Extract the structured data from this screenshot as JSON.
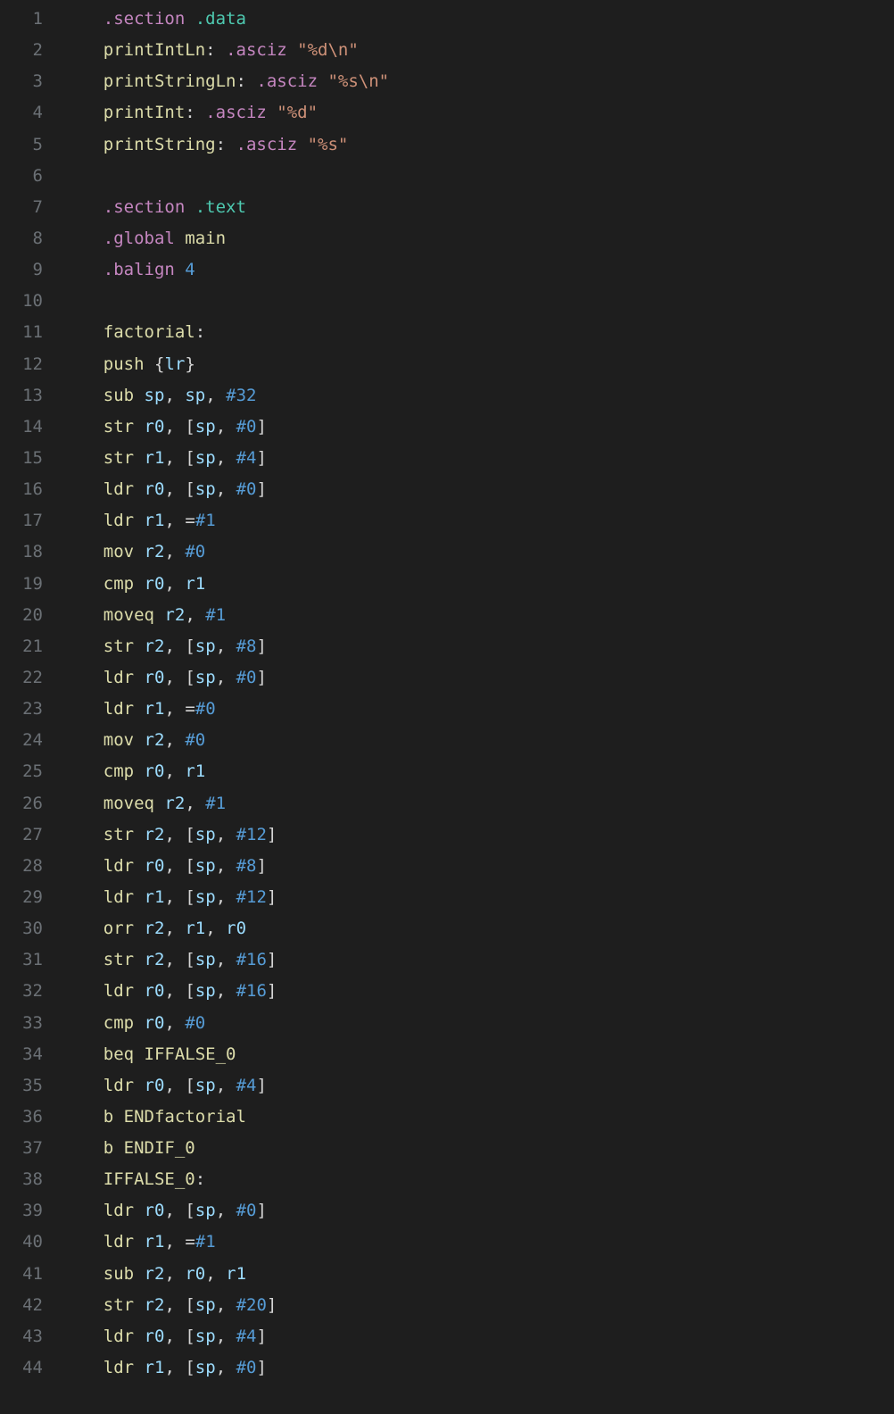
{
  "lines": [
    {
      "num": 1,
      "tokens": [
        [
          "kw",
          ".section"
        ],
        [
          "sp",
          " "
        ],
        [
          "sec",
          ".data"
        ]
      ]
    },
    {
      "num": 2,
      "tokens": [
        [
          "label",
          "printIntLn"
        ],
        [
          "punc",
          ":"
        ],
        [
          "sp",
          " "
        ],
        [
          "dir",
          ".asciz"
        ],
        [
          "sp",
          " "
        ],
        [
          "str",
          "\"%d\\n\""
        ]
      ]
    },
    {
      "num": 3,
      "tokens": [
        [
          "label",
          "printStringLn"
        ],
        [
          "punc",
          ":"
        ],
        [
          "sp",
          " "
        ],
        [
          "dir",
          ".asciz"
        ],
        [
          "sp",
          " "
        ],
        [
          "str",
          "\"%s\\n\""
        ]
      ]
    },
    {
      "num": 4,
      "tokens": [
        [
          "label",
          "printInt"
        ],
        [
          "punc",
          ":"
        ],
        [
          "sp",
          " "
        ],
        [
          "dir",
          ".asciz"
        ],
        [
          "sp",
          " "
        ],
        [
          "str",
          "\"%d\""
        ]
      ]
    },
    {
      "num": 5,
      "tokens": [
        [
          "label",
          "printString"
        ],
        [
          "punc",
          ":"
        ],
        [
          "sp",
          " "
        ],
        [
          "dir",
          ".asciz"
        ],
        [
          "sp",
          " "
        ],
        [
          "str",
          "\"%s\""
        ]
      ]
    },
    {
      "num": 6,
      "tokens": []
    },
    {
      "num": 7,
      "tokens": [
        [
          "kw",
          ".section"
        ],
        [
          "sp",
          " "
        ],
        [
          "sec",
          ".text"
        ]
      ]
    },
    {
      "num": 8,
      "tokens": [
        [
          "kw",
          ".global"
        ],
        [
          "sp",
          " "
        ],
        [
          "main",
          "main"
        ]
      ]
    },
    {
      "num": 9,
      "tokens": [
        [
          "kw",
          ".balign"
        ],
        [
          "sp",
          " "
        ],
        [
          "num",
          "4"
        ]
      ]
    },
    {
      "num": 10,
      "tokens": []
    },
    {
      "num": 11,
      "tokens": [
        [
          "label",
          "factorial"
        ],
        [
          "punc",
          ":"
        ]
      ]
    },
    {
      "num": 12,
      "tokens": [
        [
          "mn",
          "push"
        ],
        [
          "sp",
          " "
        ],
        [
          "punc",
          "{"
        ],
        [
          "reg",
          "lr"
        ],
        [
          "punc",
          "}"
        ]
      ]
    },
    {
      "num": 13,
      "tokens": [
        [
          "mn",
          "sub"
        ],
        [
          "sp",
          " "
        ],
        [
          "reg",
          "sp"
        ],
        [
          "punc",
          ","
        ],
        [
          "sp",
          " "
        ],
        [
          "reg",
          "sp"
        ],
        [
          "punc",
          ","
        ],
        [
          "sp",
          " "
        ],
        [
          "num",
          "#32"
        ]
      ]
    },
    {
      "num": 14,
      "tokens": [
        [
          "mn",
          "str"
        ],
        [
          "sp",
          " "
        ],
        [
          "reg",
          "r0"
        ],
        [
          "punc",
          ","
        ],
        [
          "sp",
          " "
        ],
        [
          "punc",
          "["
        ],
        [
          "reg",
          "sp"
        ],
        [
          "punc",
          ","
        ],
        [
          "sp",
          " "
        ],
        [
          "num",
          "#0"
        ],
        [
          "punc",
          "]"
        ]
      ]
    },
    {
      "num": 15,
      "tokens": [
        [
          "mn",
          "str"
        ],
        [
          "sp",
          " "
        ],
        [
          "reg",
          "r1"
        ],
        [
          "punc",
          ","
        ],
        [
          "sp",
          " "
        ],
        [
          "punc",
          "["
        ],
        [
          "reg",
          "sp"
        ],
        [
          "punc",
          ","
        ],
        [
          "sp",
          " "
        ],
        [
          "num",
          "#4"
        ],
        [
          "punc",
          "]"
        ]
      ]
    },
    {
      "num": 16,
      "tokens": [
        [
          "mn",
          "ldr"
        ],
        [
          "sp",
          " "
        ],
        [
          "reg",
          "r0"
        ],
        [
          "punc",
          ","
        ],
        [
          "sp",
          " "
        ],
        [
          "punc",
          "["
        ],
        [
          "reg",
          "sp"
        ],
        [
          "punc",
          ","
        ],
        [
          "sp",
          " "
        ],
        [
          "num",
          "#0"
        ],
        [
          "punc",
          "]"
        ]
      ]
    },
    {
      "num": 17,
      "tokens": [
        [
          "mn",
          "ldr"
        ],
        [
          "sp",
          " "
        ],
        [
          "reg",
          "r1"
        ],
        [
          "punc",
          ","
        ],
        [
          "sp",
          " "
        ],
        [
          "eq",
          "="
        ],
        [
          "num",
          "#1"
        ]
      ]
    },
    {
      "num": 18,
      "tokens": [
        [
          "mn",
          "mov"
        ],
        [
          "sp",
          " "
        ],
        [
          "reg",
          "r2"
        ],
        [
          "punc",
          ","
        ],
        [
          "sp",
          " "
        ],
        [
          "num",
          "#0"
        ]
      ]
    },
    {
      "num": 19,
      "tokens": [
        [
          "mn",
          "cmp"
        ],
        [
          "sp",
          " "
        ],
        [
          "reg",
          "r0"
        ],
        [
          "punc",
          ","
        ],
        [
          "sp",
          " "
        ],
        [
          "reg",
          "r1"
        ]
      ]
    },
    {
      "num": 20,
      "tokens": [
        [
          "mn",
          "moveq"
        ],
        [
          "sp",
          " "
        ],
        [
          "reg",
          "r2"
        ],
        [
          "punc",
          ","
        ],
        [
          "sp",
          " "
        ],
        [
          "num",
          "#1"
        ]
      ]
    },
    {
      "num": 21,
      "tokens": [
        [
          "mn",
          "str"
        ],
        [
          "sp",
          " "
        ],
        [
          "reg",
          "r2"
        ],
        [
          "punc",
          ","
        ],
        [
          "sp",
          " "
        ],
        [
          "punc",
          "["
        ],
        [
          "reg",
          "sp"
        ],
        [
          "punc",
          ","
        ],
        [
          "sp",
          " "
        ],
        [
          "num",
          "#8"
        ],
        [
          "punc",
          "]"
        ]
      ]
    },
    {
      "num": 22,
      "tokens": [
        [
          "mn",
          "ldr"
        ],
        [
          "sp",
          " "
        ],
        [
          "reg",
          "r0"
        ],
        [
          "punc",
          ","
        ],
        [
          "sp",
          " "
        ],
        [
          "punc",
          "["
        ],
        [
          "reg",
          "sp"
        ],
        [
          "punc",
          ","
        ],
        [
          "sp",
          " "
        ],
        [
          "num",
          "#0"
        ],
        [
          "punc",
          "]"
        ]
      ]
    },
    {
      "num": 23,
      "tokens": [
        [
          "mn",
          "ldr"
        ],
        [
          "sp",
          " "
        ],
        [
          "reg",
          "r1"
        ],
        [
          "punc",
          ","
        ],
        [
          "sp",
          " "
        ],
        [
          "eq",
          "="
        ],
        [
          "num",
          "#0"
        ]
      ]
    },
    {
      "num": 24,
      "tokens": [
        [
          "mn",
          "mov"
        ],
        [
          "sp",
          " "
        ],
        [
          "reg",
          "r2"
        ],
        [
          "punc",
          ","
        ],
        [
          "sp",
          " "
        ],
        [
          "num",
          "#0"
        ]
      ]
    },
    {
      "num": 25,
      "tokens": [
        [
          "mn",
          "cmp"
        ],
        [
          "sp",
          " "
        ],
        [
          "reg",
          "r0"
        ],
        [
          "punc",
          ","
        ],
        [
          "sp",
          " "
        ],
        [
          "reg",
          "r1"
        ]
      ]
    },
    {
      "num": 26,
      "tokens": [
        [
          "mn",
          "moveq"
        ],
        [
          "sp",
          " "
        ],
        [
          "reg",
          "r2"
        ],
        [
          "punc",
          ","
        ],
        [
          "sp",
          " "
        ],
        [
          "num",
          "#1"
        ]
      ]
    },
    {
      "num": 27,
      "tokens": [
        [
          "mn",
          "str"
        ],
        [
          "sp",
          " "
        ],
        [
          "reg",
          "r2"
        ],
        [
          "punc",
          ","
        ],
        [
          "sp",
          " "
        ],
        [
          "punc",
          "["
        ],
        [
          "reg",
          "sp"
        ],
        [
          "punc",
          ","
        ],
        [
          "sp",
          " "
        ],
        [
          "num",
          "#12"
        ],
        [
          "punc",
          "]"
        ]
      ]
    },
    {
      "num": 28,
      "tokens": [
        [
          "mn",
          "ldr"
        ],
        [
          "sp",
          " "
        ],
        [
          "reg",
          "r0"
        ],
        [
          "punc",
          ","
        ],
        [
          "sp",
          " "
        ],
        [
          "punc",
          "["
        ],
        [
          "reg",
          "sp"
        ],
        [
          "punc",
          ","
        ],
        [
          "sp",
          " "
        ],
        [
          "num",
          "#8"
        ],
        [
          "punc",
          "]"
        ]
      ]
    },
    {
      "num": 29,
      "tokens": [
        [
          "mn",
          "ldr"
        ],
        [
          "sp",
          " "
        ],
        [
          "reg",
          "r1"
        ],
        [
          "punc",
          ","
        ],
        [
          "sp",
          " "
        ],
        [
          "punc",
          "["
        ],
        [
          "reg",
          "sp"
        ],
        [
          "punc",
          ","
        ],
        [
          "sp",
          " "
        ],
        [
          "num",
          "#12"
        ],
        [
          "punc",
          "]"
        ]
      ]
    },
    {
      "num": 30,
      "tokens": [
        [
          "mn",
          "orr"
        ],
        [
          "sp",
          " "
        ],
        [
          "reg",
          "r2"
        ],
        [
          "punc",
          ","
        ],
        [
          "sp",
          " "
        ],
        [
          "reg",
          "r1"
        ],
        [
          "punc",
          ","
        ],
        [
          "sp",
          " "
        ],
        [
          "reg",
          "r0"
        ]
      ]
    },
    {
      "num": 31,
      "tokens": [
        [
          "mn",
          "str"
        ],
        [
          "sp",
          " "
        ],
        [
          "reg",
          "r2"
        ],
        [
          "punc",
          ","
        ],
        [
          "sp",
          " "
        ],
        [
          "punc",
          "["
        ],
        [
          "reg",
          "sp"
        ],
        [
          "punc",
          ","
        ],
        [
          "sp",
          " "
        ],
        [
          "num",
          "#16"
        ],
        [
          "punc",
          "]"
        ]
      ]
    },
    {
      "num": 32,
      "tokens": [
        [
          "mn",
          "ldr"
        ],
        [
          "sp",
          " "
        ],
        [
          "reg",
          "r0"
        ],
        [
          "punc",
          ","
        ],
        [
          "sp",
          " "
        ],
        [
          "punc",
          "["
        ],
        [
          "reg",
          "sp"
        ],
        [
          "punc",
          ","
        ],
        [
          "sp",
          " "
        ],
        [
          "num",
          "#16"
        ],
        [
          "punc",
          "]"
        ]
      ]
    },
    {
      "num": 33,
      "tokens": [
        [
          "mn",
          "cmp"
        ],
        [
          "sp",
          " "
        ],
        [
          "reg",
          "r0"
        ],
        [
          "punc",
          ","
        ],
        [
          "sp",
          " "
        ],
        [
          "num",
          "#0"
        ]
      ]
    },
    {
      "num": 34,
      "tokens": [
        [
          "mn",
          "beq"
        ],
        [
          "sp",
          " "
        ],
        [
          "label",
          "IFFALSE_0"
        ]
      ]
    },
    {
      "num": 35,
      "tokens": [
        [
          "mn",
          "ldr"
        ],
        [
          "sp",
          " "
        ],
        [
          "reg",
          "r0"
        ],
        [
          "punc",
          ","
        ],
        [
          "sp",
          " "
        ],
        [
          "punc",
          "["
        ],
        [
          "reg",
          "sp"
        ],
        [
          "punc",
          ","
        ],
        [
          "sp",
          " "
        ],
        [
          "num",
          "#4"
        ],
        [
          "punc",
          "]"
        ]
      ]
    },
    {
      "num": 36,
      "tokens": [
        [
          "mn",
          "b"
        ],
        [
          "sp",
          " "
        ],
        [
          "label",
          "ENDfactorial"
        ]
      ]
    },
    {
      "num": 37,
      "tokens": [
        [
          "mn",
          "b"
        ],
        [
          "sp",
          " "
        ],
        [
          "label",
          "ENDIF_0"
        ]
      ]
    },
    {
      "num": 38,
      "tokens": [
        [
          "label",
          "IFFALSE_0"
        ],
        [
          "punc",
          ":"
        ]
      ]
    },
    {
      "num": 39,
      "tokens": [
        [
          "mn",
          "ldr"
        ],
        [
          "sp",
          " "
        ],
        [
          "reg",
          "r0"
        ],
        [
          "punc",
          ","
        ],
        [
          "sp",
          " "
        ],
        [
          "punc",
          "["
        ],
        [
          "reg",
          "sp"
        ],
        [
          "punc",
          ","
        ],
        [
          "sp",
          " "
        ],
        [
          "num",
          "#0"
        ],
        [
          "punc",
          "]"
        ]
      ]
    },
    {
      "num": 40,
      "tokens": [
        [
          "mn",
          "ldr"
        ],
        [
          "sp",
          " "
        ],
        [
          "reg",
          "r1"
        ],
        [
          "punc",
          ","
        ],
        [
          "sp",
          " "
        ],
        [
          "eq",
          "="
        ],
        [
          "num",
          "#1"
        ]
      ]
    },
    {
      "num": 41,
      "tokens": [
        [
          "mn",
          "sub"
        ],
        [
          "sp",
          " "
        ],
        [
          "reg",
          "r2"
        ],
        [
          "punc",
          ","
        ],
        [
          "sp",
          " "
        ],
        [
          "reg",
          "r0"
        ],
        [
          "punc",
          ","
        ],
        [
          "sp",
          " "
        ],
        [
          "reg",
          "r1"
        ]
      ]
    },
    {
      "num": 42,
      "tokens": [
        [
          "mn",
          "str"
        ],
        [
          "sp",
          " "
        ],
        [
          "reg",
          "r2"
        ],
        [
          "punc",
          ","
        ],
        [
          "sp",
          " "
        ],
        [
          "punc",
          "["
        ],
        [
          "reg",
          "sp"
        ],
        [
          "punc",
          ","
        ],
        [
          "sp",
          " "
        ],
        [
          "num",
          "#20"
        ],
        [
          "punc",
          "]"
        ]
      ]
    },
    {
      "num": 43,
      "tokens": [
        [
          "mn",
          "ldr"
        ],
        [
          "sp",
          " "
        ],
        [
          "reg",
          "r0"
        ],
        [
          "punc",
          ","
        ],
        [
          "sp",
          " "
        ],
        [
          "punc",
          "["
        ],
        [
          "reg",
          "sp"
        ],
        [
          "punc",
          ","
        ],
        [
          "sp",
          " "
        ],
        [
          "num",
          "#4"
        ],
        [
          "punc",
          "]"
        ]
      ]
    },
    {
      "num": 44,
      "tokens": [
        [
          "mn",
          "ldr"
        ],
        [
          "sp",
          " "
        ],
        [
          "reg",
          "r1"
        ],
        [
          "punc",
          ","
        ],
        [
          "sp",
          " "
        ],
        [
          "punc",
          "["
        ],
        [
          "reg",
          "sp"
        ],
        [
          "punc",
          ","
        ],
        [
          "sp",
          " "
        ],
        [
          "num",
          "#0"
        ],
        [
          "punc",
          "]"
        ]
      ]
    }
  ],
  "indent": "    "
}
